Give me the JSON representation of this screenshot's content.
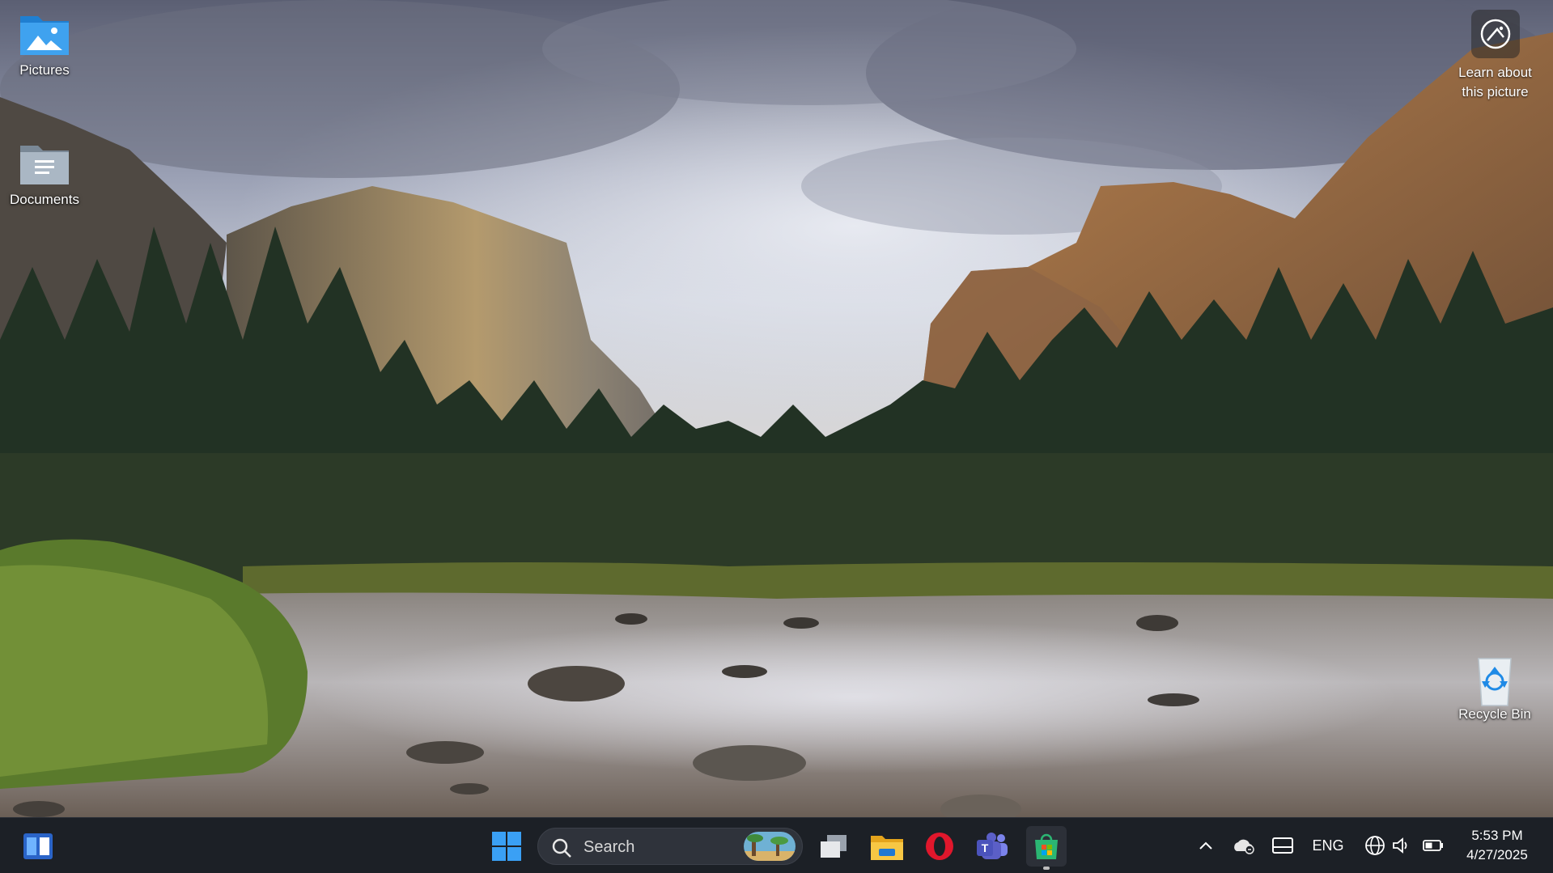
{
  "desktop": {
    "icons": [
      {
        "label": "Pictures",
        "icon": "pictures-folder-icon"
      },
      {
        "label": "Documents",
        "icon": "documents-folder-icon"
      },
      {
        "label": "Recycle Bin",
        "icon": "recycle-bin-icon"
      }
    ],
    "learn_about": {
      "line1": "Learn about",
      "line2": "this picture",
      "icon": "camera-aperture-icon"
    }
  },
  "taskbar": {
    "widgets_icon": "widgets-icon",
    "start_icon": "windows-start-icon",
    "search": {
      "placeholder": "Search"
    },
    "pinned_apps": [
      {
        "name": "Task View",
        "icon": "task-view-icon"
      },
      {
        "name": "File Explorer",
        "icon": "file-explorer-icon"
      },
      {
        "name": "Opera",
        "icon": "opera-icon"
      },
      {
        "name": "Microsoft Teams",
        "icon": "teams-icon"
      },
      {
        "name": "Active App",
        "icon": "app-store-icon"
      }
    ],
    "tray": {
      "chevron": "chevron-up-icon",
      "onedrive": "onedrive-icon",
      "display": "display-icon",
      "language": "ENG",
      "network": "globe-icon",
      "volume": "volume-icon",
      "battery": "battery-icon"
    },
    "clock": {
      "time": "5:53 PM",
      "date": "4/27/2025"
    }
  },
  "colors": {
    "taskbar_bg": "#1c2026",
    "search_bg": "#2f333b",
    "accent": "#1e90ff"
  }
}
